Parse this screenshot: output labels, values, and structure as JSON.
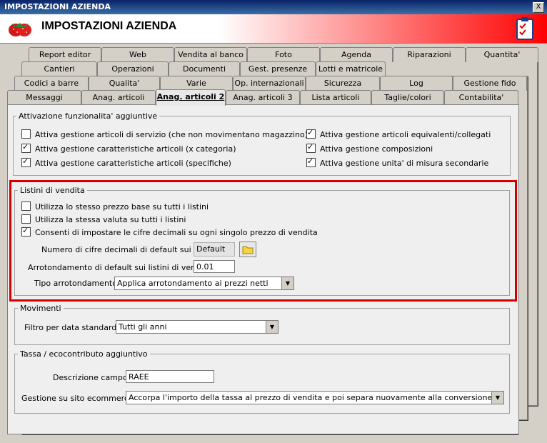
{
  "window": {
    "title": "IMPOSTAZIONI AZIENDA",
    "close_label": "X"
  },
  "header": {
    "title": "IMPOSTAZIONI AZIENDA"
  },
  "tabs": {
    "row1": [
      "Report editor",
      "Web",
      "Vendita al banco",
      "Foto",
      "Agenda",
      "Riparazioni",
      "Quantita'"
    ],
    "row2": [
      "Cantieri",
      "Operazioni",
      "Documenti",
      "Gest. presenze",
      "Lotti e matricole"
    ],
    "row3": [
      "Codici a barre",
      "Qualita'",
      "Varie",
      "Op. internazionali",
      "Sicurezza",
      "Log",
      "Gestione fido"
    ],
    "row4": [
      "Messaggi",
      "Anag. articoli",
      "Anag. articoli 2",
      "Anag. articoli 3",
      "Lista articoli",
      "Taglie/colori",
      "Contabilita'"
    ],
    "active": "Anag. articoli 2"
  },
  "attivazione": {
    "legend": "Attivazione funzionalita' aggiuntive",
    "items": [
      {
        "label": "Attiva gestione articoli di servizio (che non movimentano magazzino)",
        "checked": false
      },
      {
        "label": "Attiva gestione caratteristiche articoli (x categoria)",
        "checked": true
      },
      {
        "label": "Attiva gestione caratteristiche articoli (specifiche)",
        "checked": true
      },
      {
        "label": "Attiva gestione articoli equivalenti/collegati",
        "checked": true
      },
      {
        "label": "Attiva gestione composizioni",
        "checked": true
      },
      {
        "label": "Attiva gestione unita' di misura secondarie",
        "checked": true
      }
    ]
  },
  "listini": {
    "legend": "Listini di vendita",
    "items": [
      {
        "label": "Utilizza lo stesso prezzo base su tutti i listini",
        "checked": false
      },
      {
        "label": "Utilizza la stessa valuta su tutti i listini",
        "checked": false
      },
      {
        "label": "Consenti di impostare le cifre decimali su ogni singolo prezzo di vendita",
        "checked": true
      }
    ],
    "decimali_label": "Numero di cifre decimali di default sui listini :",
    "decimali_value": "Default",
    "arrotondamento_label": "Arrotondamento di default sui listini di vendita :",
    "arrotondamento_value": "0.01",
    "tipo_label": "Tipo arrotondamento :",
    "tipo_value": "Applica arrotondamento ai prezzi netti"
  },
  "movimenti": {
    "legend": "Movimenti",
    "filtro_label": "Filtro per data standard :",
    "filtro_value": "Tutti gli anni"
  },
  "tassa": {
    "legend": "Tassa / ecocontributo aggiuntivo",
    "descrizione_label": "Descrizione campo :",
    "descrizione_value": "RAEE",
    "ecommerce_label": "Gestione su sito ecommerce :",
    "ecommerce_value": "Accorpa l'importo della tassa al prezzo di vendita e poi separa nuovamente alla conversione dell'ordine web"
  }
}
